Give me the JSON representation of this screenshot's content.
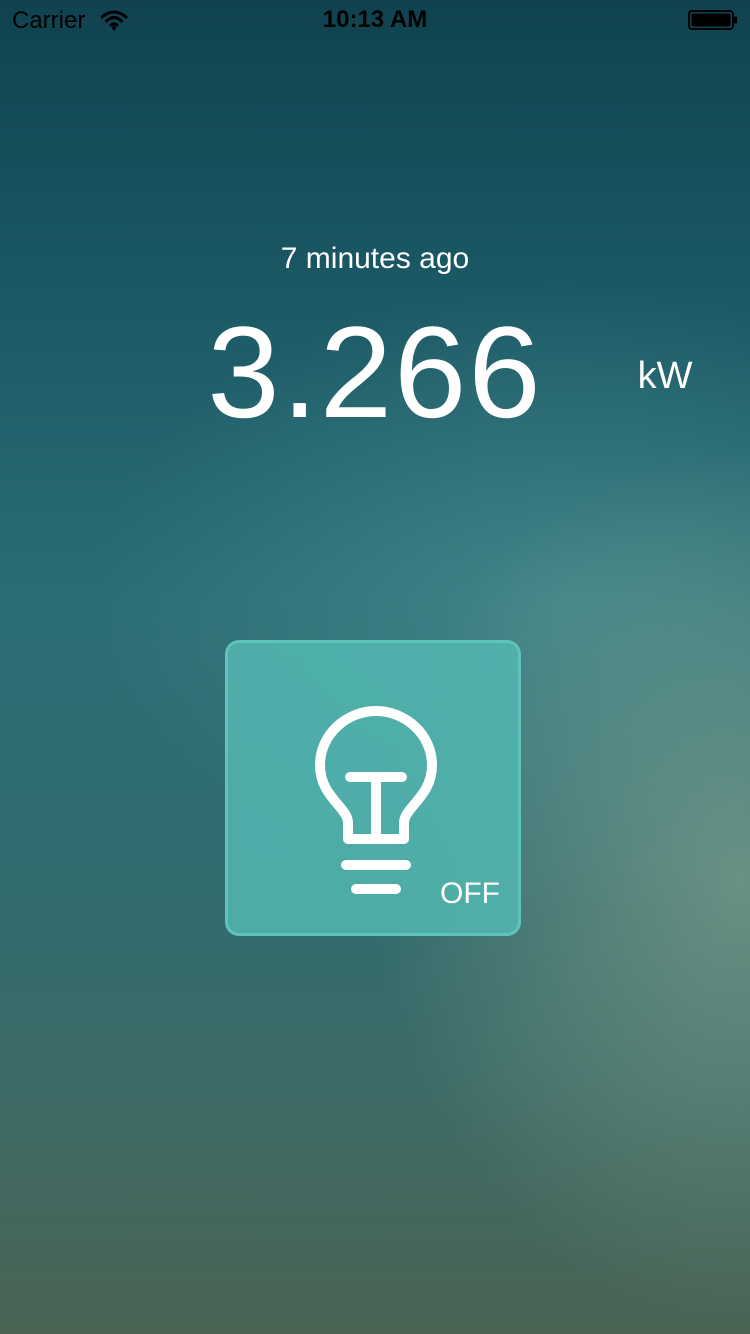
{
  "status_bar": {
    "carrier": "Carrier",
    "time": "10:13 AM",
    "icons": {
      "wifi": "wifi-icon",
      "battery": "battery-icon"
    }
  },
  "reading": {
    "last_updated": "7 minutes ago",
    "value": "3.266",
    "unit": "kW"
  },
  "light": {
    "icon": "lightbulb-icon",
    "state_label": "OFF",
    "is_on": false
  },
  "colors": {
    "tile_background": "#53b7b0",
    "tile_border": "#60c4bc",
    "text": "#ffffff",
    "status_text": "#000000"
  }
}
